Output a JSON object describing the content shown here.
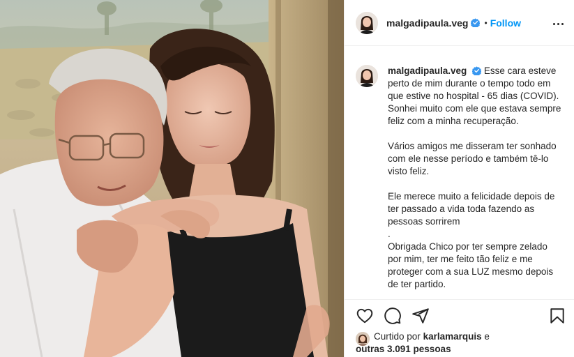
{
  "post": {
    "username": "malgadipaula.veg",
    "verified": true,
    "dot": "•",
    "follow_label": "Follow",
    "more_icon": "more-options-icon"
  },
  "caption": {
    "username": "malgadipaula.veg",
    "paragraphs": [
      "Esse cara esteve perto de mim durante o tempo todo em que estive no hospital - 65 dias (COVID). Sonhei muito com ele que estava sempre feliz com a minha recuperação.",
      "Vários amigos me disseram ter sonhado com ele nesse período e também tê-lo visto feliz.",
      "Ele merece muito a felicidade depois de ter passado a vida toda fazendo as pessoas sorrirem",
      ".",
      "Obrigada Chico por ter sempre zelado por mim, ter me feito tão feliz e me proteger com a sua LUZ mesmo depois de ter partido."
    ]
  },
  "actions": {
    "like_icon": "heart-icon",
    "comment_icon": "comment-icon",
    "share_icon": "share-icon",
    "save_icon": "bookmark-icon"
  },
  "likes": {
    "prefix": "Curtido por",
    "liker": "karlamarquis",
    "connector": "e",
    "others": "outras 3.091 pessoas"
  },
  "colors": {
    "link_blue": "#0095f6",
    "text": "#262626",
    "border": "#efefef",
    "verified_blue": "#3897f0"
  }
}
